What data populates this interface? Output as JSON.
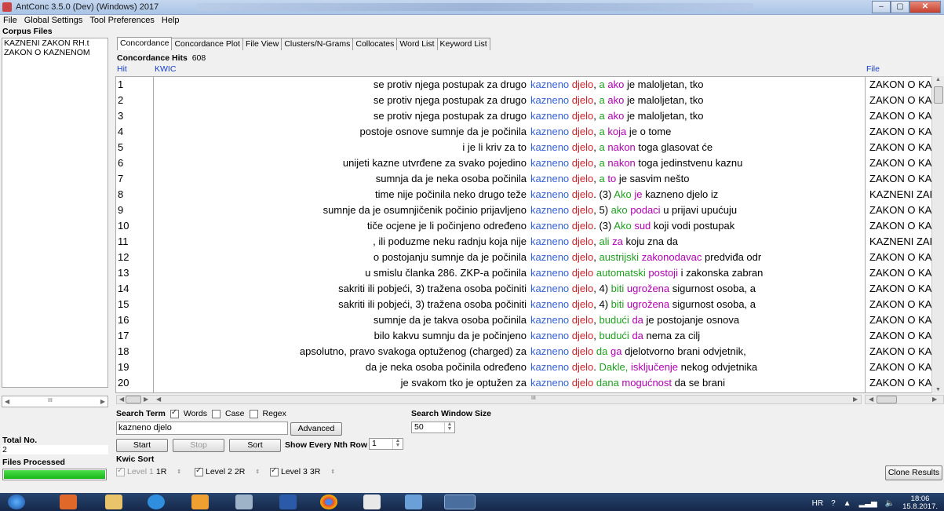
{
  "window": {
    "title": "AntConc 3.5.0 (Dev) (Windows) 2017",
    "min": "–",
    "max": "▢",
    "close": "✕"
  },
  "menu": [
    "File",
    "Global Settings",
    "Tool Preferences",
    "Help"
  ],
  "left": {
    "corpus_label": "Corpus Files",
    "files": [
      "KAZNENI ZAKON RH.t",
      "ZAKON O KAZNENOM"
    ],
    "scroll_thumb": "III",
    "total_label": "Total No.",
    "total": "2",
    "processed_label": "Files Processed",
    "progress": 1.0
  },
  "tabs": [
    "Concordance",
    "Concordance Plot",
    "File View",
    "Clusters/N-Grams",
    "Collocates",
    "Word List",
    "Keyword List"
  ],
  "active_tab": 0,
  "hits": {
    "label": "Concordance Hits",
    "count": "608"
  },
  "columns": {
    "hit": "Hit",
    "kwic": "KWIC",
    "file": "File"
  },
  "rows": [
    {
      "n": "1",
      "left": "se protiv njega postupak za drugo",
      "kw": "kazneno",
      "r1": "djelo",
      "mid": ",",
      "r2": "a",
      "r3": "ako",
      "rest": "je maloljetan, tko",
      "file": "ZAKON O KAZNENOM"
    },
    {
      "n": "2",
      "left": "se protiv njega postupak za drugo",
      "kw": "kazneno",
      "r1": "djelo",
      "mid": ",",
      "r2": "a",
      "r3": "ako",
      "rest": "je maloljetan, tko",
      "file": "ZAKON O KAZNENOM"
    },
    {
      "n": "3",
      "left": "se protiv njega postupak za drugo",
      "kw": "kazneno",
      "r1": "djelo",
      "mid": ",",
      "r2": "a",
      "r3": "ako",
      "rest": "je maloljetan, tko",
      "file": "ZAKON O KAZNENOM"
    },
    {
      "n": "4",
      "left": "postoje osnove sumnje da je počinila",
      "kw": "kazneno",
      "r1": "djelo",
      "mid": ",",
      "r2": "a",
      "r3": "koja",
      "rest": "je o tome",
      "file": "ZAKON O KAZNENOM"
    },
    {
      "n": "5",
      "left": "i je li kriv za to",
      "kw": "kazneno",
      "r1": "djelo",
      "mid": ",",
      "r2": "a",
      "r3": "nakon",
      "rest": "toga glasovat će",
      "file": "ZAKON O KAZNENOM"
    },
    {
      "n": "6",
      "left": "unijeti kazne utvrđene za svako pojedino",
      "kw": "kazneno",
      "r1": "djelo",
      "mid": ",",
      "r2": "a",
      "r3": "nakon",
      "rest": "toga jedinstvenu kaznu",
      "file": "ZAKON O KAZNENOM"
    },
    {
      "n": "7",
      "left": "sumnja da je neka osoba počinila",
      "kw": "kazneno",
      "r1": "djelo",
      "mid": ",",
      "r2": "a",
      "r3": "to",
      "rest": "je sasvim nešto",
      "file": "ZAKON O KAZNENOM"
    },
    {
      "n": "8",
      "left": "time nije počinila neko drugo teže",
      "kw": "kazneno",
      "r1": "djelo",
      "mid": ". (3)",
      "r2": "Ako",
      "r3": "je",
      "rest": "kazneno djelo iz",
      "file": "KAZNENI ZAKON RH"
    },
    {
      "n": "9",
      "left": "sumnje da je osumnjičenik počinio prijavljeno",
      "kw": "kazneno",
      "r1": "djelo",
      "mid": ", 5)",
      "r2": "ako",
      "r3": "podaci",
      "rest": "u prijavi upućuju",
      "file": "ZAKON O KAZNENOM"
    },
    {
      "n": "10",
      "left": "tiče ocjene je li počinjeno određeno",
      "kw": "kazneno",
      "r1": "djelo",
      "mid": ". (3)",
      "r2": "Ako",
      "r3": "sud",
      "rest": "koji vodi postupak",
      "file": "ZAKON O KAZNENOM"
    },
    {
      "n": "11",
      "left": ", ili poduzme neku radnju koja nije",
      "kw": "kazneno",
      "r1": "djelo",
      "mid": ",",
      "r2": "ali",
      "r3": "za",
      "rest": "koju zna da",
      "file": "KAZNENI ZAKON RH"
    },
    {
      "n": "12",
      "left": "o postojanju sumnje da je počinila",
      "kw": "kazneno",
      "r1": "djelo",
      "mid": ",",
      "r2": "austrijski",
      "r3": "zakonodavac",
      "rest": "predviđa odr",
      "file": "ZAKON O KAZNENOM"
    },
    {
      "n": "13",
      "left": "u smislu članka 286. ZKP-a počinila",
      "kw": "kazneno",
      "r1": "djelo",
      "mid": "",
      "r2": "automatski",
      "r3": "postoji",
      "rest": "i zakonska zabran",
      "file": "ZAKON O KAZNENOM"
    },
    {
      "n": "14",
      "left": "sakriti ili pobjeći, 3) tražena osoba počiniti",
      "kw": "kazneno",
      "r1": "djelo",
      "mid": ", 4)",
      "r2": "biti",
      "r3": "ugrožena",
      "rest": "sigurnost osoba, a",
      "file": "ZAKON O KAZNENOM"
    },
    {
      "n": "15",
      "left": "sakriti ili pobjeći, 3) tražena osoba počiniti",
      "kw": "kazneno",
      "r1": "djelo",
      "mid": ", 4)",
      "r2": "biti",
      "r3": "ugrožena",
      "rest": "sigurnost osoba, a",
      "file": "ZAKON O KAZNENOM"
    },
    {
      "n": "16",
      "left": "sumnje da je takva osoba počinila",
      "kw": "kazneno",
      "r1": "djelo",
      "mid": ",",
      "r2": "budući",
      "r3": "da",
      "rest": "je postojanje osnova",
      "file": "ZAKON O KAZNENOM"
    },
    {
      "n": "17",
      "left": "bilo kakvu sumnju da je počinjeno",
      "kw": "kazneno",
      "r1": "djelo",
      "mid": ",",
      "r2": "budući",
      "r3": "da",
      "rest": "nema za cilj",
      "file": "ZAKON O KAZNENOM"
    },
    {
      "n": "18",
      "left": "apsolutno, pravo svakoga optuženog (charged) za",
      "kw": "kazneno",
      "r1": "djelo",
      "mid": "",
      "r2": "da",
      "r3": "ga",
      "rest": "djelotvorno brani odvjetnik,",
      "file": "ZAKON O KAZNENOM"
    },
    {
      "n": "19",
      "left": "da je neka osoba počinila određeno",
      "kw": "kazneno",
      "r1": "djelo",
      "mid": ".",
      "r2": "Dakle,",
      "r3": "isključenje",
      "rest": "nekog odvjetnika",
      "file": "ZAKON O KAZNENOM"
    },
    {
      "n": "20",
      "left": "je svakom tko je optužen za",
      "kw": "kazneno",
      "r1": "djelo",
      "mid": "",
      "r2": "dana",
      "r3": "mogućnost",
      "rest": "da se brani",
      "file": "ZAKON O KAZNENOM"
    }
  ],
  "hscroll_thumb": "III",
  "search": {
    "label": "Search Term",
    "words": "Words",
    "case": "Case",
    "regex": "Regex",
    "value": "kazneno djelo",
    "advanced": "Advanced",
    "start": "Start",
    "stop": "Stop",
    "sort": "Sort",
    "nth_label": "Show Every Nth Row",
    "nth": "1",
    "window_label": "Search Window Size",
    "window": "50"
  },
  "kwic_sort": {
    "label": "Kwic Sort",
    "l1": "Level 1",
    "l1v": "1R",
    "l2": "Level 2",
    "l2v": "2R",
    "l3": "Level 3",
    "l3v": "3R"
  },
  "clone": "Clone Results",
  "tray": {
    "lang": "HR",
    "time": "18:06",
    "date": "15.8.2017."
  }
}
